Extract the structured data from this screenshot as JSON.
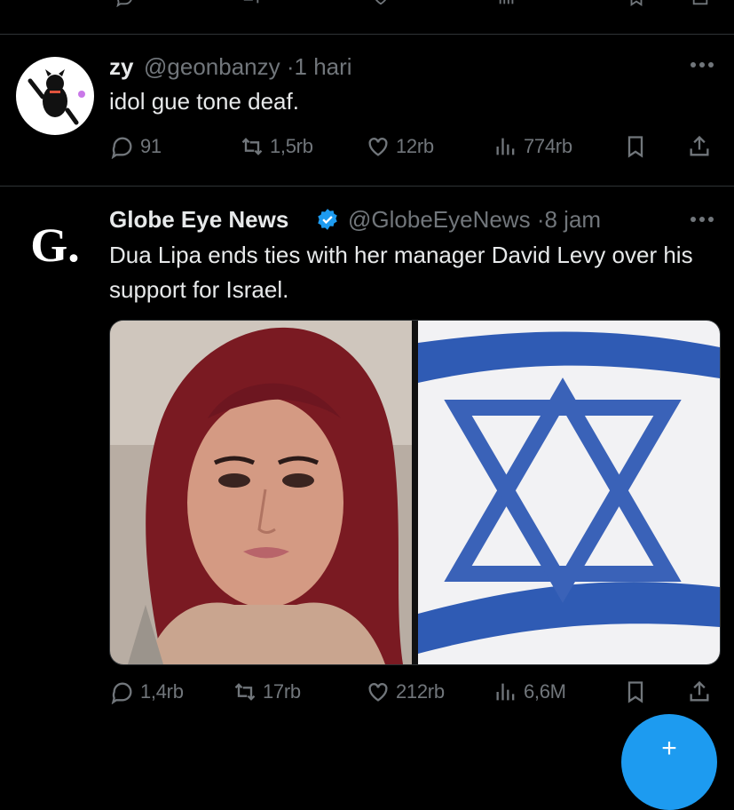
{
  "tweets": [
    {
      "display_name": "zy",
      "handle": "@geonbanzy",
      "time": "1 hari",
      "text": "idol gue tone deaf.",
      "replies": "91",
      "reposts": "1,5rb",
      "likes": "12rb",
      "views": "774rb"
    },
    {
      "display_name": "Globe Eye News",
      "handle": "@GlobeEyeNews",
      "time": "8 jam",
      "text": "Dua Lipa ends ties with her manager David Levy over his support for Israel.",
      "avatar_letter": "G.",
      "verified": true,
      "replies": "1,4rb",
      "reposts": "17rb",
      "likes": "212rb",
      "views": "6,6M"
    }
  ],
  "colors": {
    "background": "#000000",
    "text": "#e7e9ea",
    "muted": "#71767b",
    "accent": "#1d9bf0",
    "divider": "#2f3336"
  },
  "icons": [
    "reply-icon",
    "repost-icon",
    "like-icon",
    "views-icon",
    "bookmark-icon",
    "share-icon",
    "more-icon",
    "verified-badge-icon"
  ]
}
